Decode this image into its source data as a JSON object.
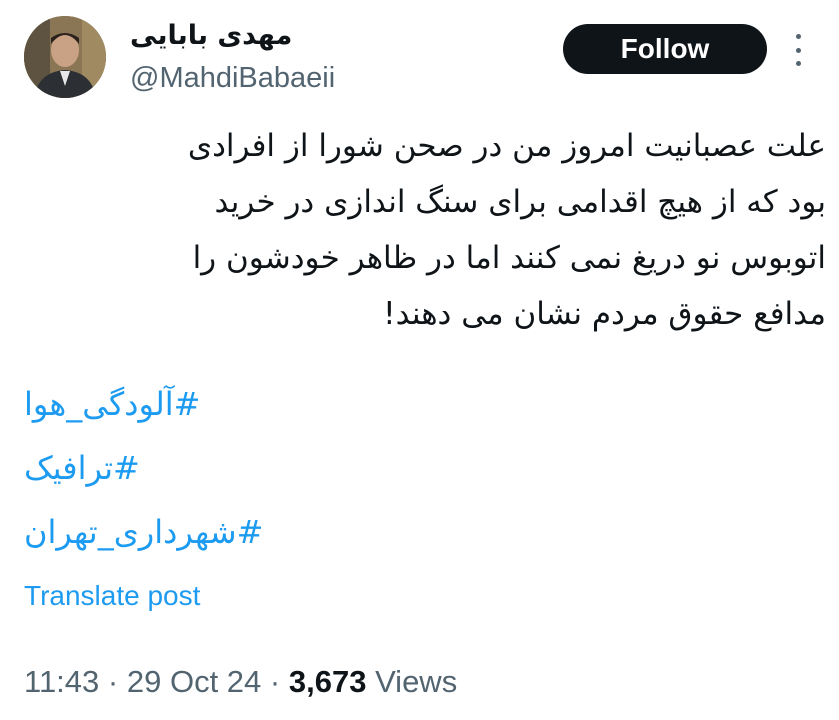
{
  "author": {
    "display_name": "مهدی بابایی",
    "handle": "@MahdiBabaeii",
    "avatar_icon": "user-photo-icon"
  },
  "header": {
    "follow_label": "Follow",
    "more_icon": "more-options-icon"
  },
  "tweet": {
    "lines": [
      "علت عصبانیت امروز من در صحن شورا از افرادی",
      "بود که از هیچ اقدامی برای سنگ اندازی در خرید",
      "اتوبوس نو دریغ نمی کنند اما در ظاهر خودشون را",
      "مدافع حقوق مردم نشان می دهند!"
    ],
    "hashtags": [
      "#آلودگی_هوا",
      "#ترافیک",
      "#شهرداری_تهران"
    ],
    "translate_label": "Translate post"
  },
  "meta": {
    "time": "11:43",
    "separator": "·",
    "date": "29 Oct 24",
    "views_count": "3,673",
    "views_label": "Views"
  },
  "colors": {
    "link": "#1d9bf0",
    "muted": "#536471",
    "text": "#0f1419",
    "button_bg": "#0f1419"
  }
}
